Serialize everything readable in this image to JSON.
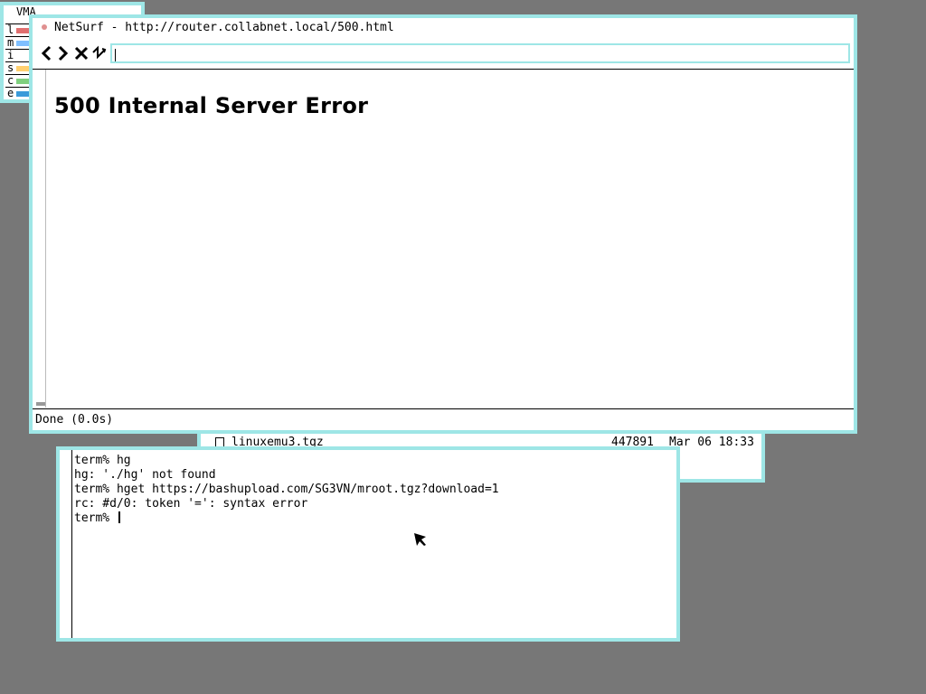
{
  "vmap": {
    "title": "VMA",
    "rows": [
      {
        "letter": "l",
        "color": "#e07070"
      },
      {
        "letter": "m",
        "color": "#7fbfff"
      },
      {
        "letter": "i",
        "color": "#ffffff"
      },
      {
        "letter": "s",
        "color": "#ffd070"
      },
      {
        "letter": "c",
        "color": "#7fd07f"
      },
      {
        "letter": "e",
        "color": "#3a9ad9"
      }
    ]
  },
  "netsurf": {
    "title": "NetSurf - http://router.collabnet.local/500.html",
    "toolbar": {
      "back_icon": "chevron-left-icon",
      "forward_icon": "chevron-right-icon",
      "stop_icon": "close-icon",
      "reload_icon": "reload-icon",
      "url_value": ""
    },
    "page_heading": "500 Internal Server Error",
    "status": "Done (0.0s)"
  },
  "files": {
    "rows": [
      {
        "icon": "file-icon",
        "name": "linuxemu3.tgz",
        "size": "447891",
        "date": "Mar 06 18:33"
      }
    ]
  },
  "terminal": {
    "lines": [
      "term% hg",
      "hg: './hg' not found",
      "term% hget https://bashupload.com/SG3VN/mroot.tgz?download=1",
      "rc: #d/0: token '=': syntax error",
      "term% "
    ]
  },
  "colors": {
    "desktop": "#777777",
    "window_border": "#9ee6e6"
  }
}
